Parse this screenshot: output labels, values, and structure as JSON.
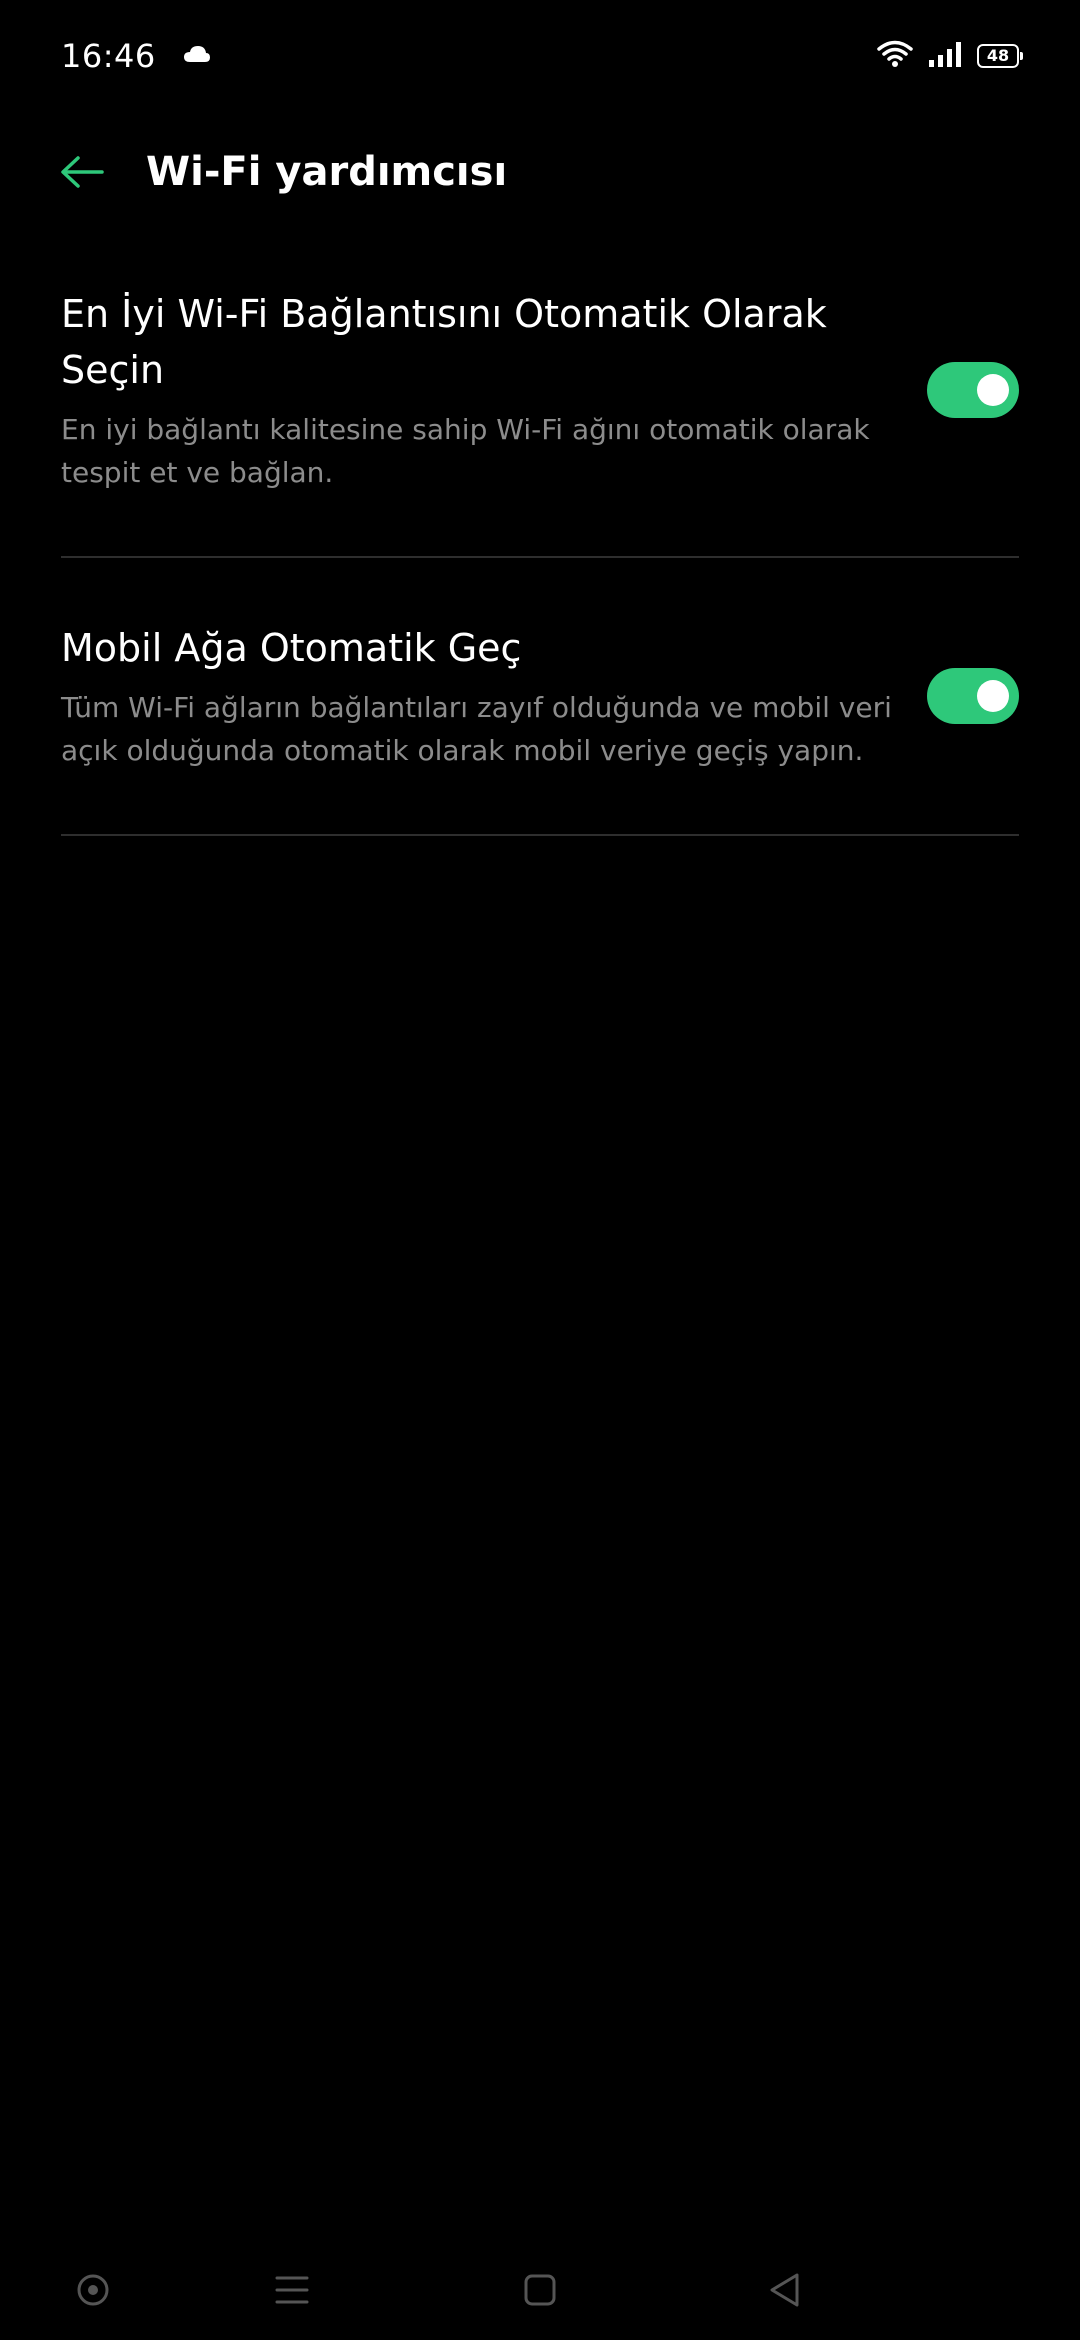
{
  "status_bar": {
    "time": "16:46",
    "battery": "48",
    "icons": [
      "cloud-icon",
      "wifi-icon",
      "signal-icon",
      "battery-icon"
    ]
  },
  "header": {
    "title": "Wi-Fi yardımcısı",
    "back_icon": "arrow-left-icon"
  },
  "settings": [
    {
      "title": "En İyi Wi-Fi Bağlantısını Otomatik Olarak Seçin",
      "description": "En iyi bağlantı kalitesine sahip Wi-Fi ağını otomatik olarak tespit et ve bağlan.",
      "enabled": true
    },
    {
      "title": "Mobil Ağa Otomatik Geç",
      "description": "Tüm Wi-Fi ağların bağlantıları zayıf olduğunda ve mobil veri açık olduğunda otomatik olarak mobil veriye geçiş yapın.",
      "enabled": true
    }
  ],
  "nav_bar": {
    "icons": [
      "assistant-dot-icon",
      "menu-lines-icon",
      "home-square-icon",
      "back-triangle-icon"
    ]
  },
  "colors": {
    "accent": "#2ec87a",
    "background": "#000000",
    "secondary_text": "#8c8c8c",
    "divider": "#2e2e2e"
  }
}
